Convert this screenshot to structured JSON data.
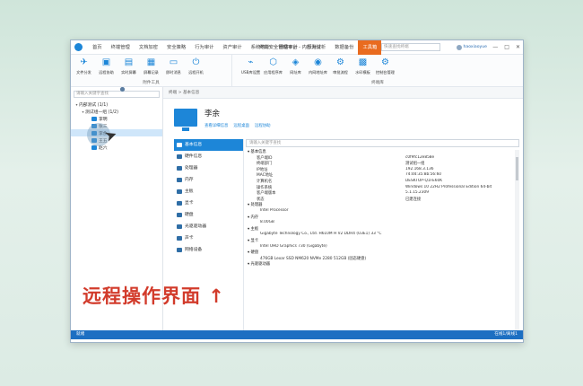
{
  "header": {
    "menu": [
      "首页",
      "终端管理",
      "文档加密",
      "安全策略",
      "行为审计",
      "资产审计",
      "系统统计",
      "网络审计",
      "行为分析",
      "数据备份",
      "工具箱",
      "系统管理"
    ],
    "active_menu": "工具箱",
    "title": "终端安全管理平台 - 内部测试",
    "search_placeholder": "快速查找终端",
    "user_name": "haoxiaoyue",
    "window_buttons": [
      "—",
      "□",
      "✕"
    ]
  },
  "toolbar": {
    "group1": {
      "label": "附件工具",
      "tools": [
        {
          "icon": "send-icon",
          "glyph": "✈",
          "label": "文件分发"
        },
        {
          "icon": "monitor-icon",
          "glyph": "▣",
          "label": "远程协助"
        },
        {
          "icon": "screen-icon",
          "glyph": "▤",
          "label": "实时屏幕"
        },
        {
          "icon": "terminal-icon",
          "glyph": "▦",
          "label": "屏幕记录"
        },
        {
          "icon": "chat-icon",
          "glyph": "▭",
          "label": "即时消息"
        },
        {
          "icon": "power-icon",
          "glyph": "⏻",
          "label": "远程开机"
        }
      ]
    },
    "group2": {
      "label": "终端库",
      "tools": [
        {
          "icon": "usb-icon",
          "glyph": "⌁",
          "label": "USB库设置"
        },
        {
          "icon": "app-icon",
          "glyph": "⬡",
          "label": "应用程序库"
        },
        {
          "icon": "web-icon",
          "glyph": "◈",
          "label": "网址库"
        },
        {
          "icon": "ip-icon",
          "glyph": "◉",
          "label": "内网地址库"
        },
        {
          "icon": "gear-icon",
          "glyph": "⚙",
          "label": "审批流程"
        },
        {
          "icon": "grid-icon",
          "glyph": "▩",
          "label": "水印模板"
        },
        {
          "icon": "settings-icon",
          "glyph": "⚙",
          "label": "控制台管理"
        }
      ]
    }
  },
  "left_panel": {
    "filter_placeholder": "请输入关键字查找",
    "tree": [
      {
        "label": "内部测试 (1/1)",
        "level": 0,
        "type": "user"
      },
      {
        "label": "测试组一组 (1/2)",
        "level": 1,
        "type": "user"
      },
      {
        "label": "李明",
        "level": 2,
        "type": "pc"
      },
      {
        "label": "张三",
        "level": 2,
        "type": "pc"
      },
      {
        "label": "李余",
        "level": 2,
        "type": "pc",
        "selected": true
      },
      {
        "label": "王五",
        "level": 2,
        "type": "pc"
      },
      {
        "label": "赵六",
        "level": 2,
        "type": "pc"
      }
    ]
  },
  "detail": {
    "breadcrumb": "终端 > 基本信息",
    "device_name": "李余",
    "actions": [
      "查看详细信息",
      "远程桌面",
      "远程协助"
    ],
    "search_placeholder": "请输入关键字查找",
    "categories": [
      {
        "label": "基本信息",
        "active": true
      },
      {
        "label": "硬件信息"
      },
      {
        "label": "处理器"
      },
      {
        "label": "内存"
      },
      {
        "label": "主板"
      },
      {
        "label": "显卡"
      },
      {
        "label": "硬盘"
      },
      {
        "label": "光驱驱动器"
      },
      {
        "label": "声卡"
      },
      {
        "label": "网络设备"
      }
    ],
    "rows": [
      {
        "type": "sec",
        "k": "▾ 基本信息",
        "v": ""
      },
      {
        "type": "row",
        "k": "客户端ID",
        "v": "c0f9fc12e858e"
      },
      {
        "type": "row",
        "k": "终端部门",
        "v": "测试组一组"
      },
      {
        "type": "row",
        "k": "IP地址",
        "v": "192.168.3.136"
      },
      {
        "type": "row",
        "k": "MAC地址",
        "v": "74:d4:35:8b:56:60"
      },
      {
        "type": "row",
        "k": "计算机名",
        "v": "DESKTOP-Q1FE60K"
      },
      {
        "type": "row",
        "k": "操作系统",
        "v": "Windows 10 22H2 Professional Edition 64-bit"
      },
      {
        "type": "row",
        "k": "客户端版本",
        "v": "5.1.15.2309"
      },
      {
        "type": "row",
        "k": "状态",
        "v": "已建连接"
      },
      {
        "type": "sec",
        "k": "▾ 处理器",
        "v": ""
      },
      {
        "type": "val",
        "k": "Intel Processor",
        "v": ""
      },
      {
        "type": "sec",
        "k": "▾ 内存",
        "v": ""
      },
      {
        "type": "val",
        "k": "8.00GB",
        "v": ""
      },
      {
        "type": "sec",
        "k": "▾ 主板",
        "v": ""
      },
      {
        "type": "val",
        "k": "Gigabyte Technology Co., Ltd. H610M H V2 DDR4 (U3E1)  33 °C",
        "v": ""
      },
      {
        "type": "sec",
        "k": "▾ 显卡",
        "v": ""
      },
      {
        "type": "val",
        "k": "Intel UHD Graphics 730 (Gigabyte)",
        "v": ""
      },
      {
        "type": "sec",
        "k": "▾ 硬盘",
        "v": ""
      },
      {
        "type": "val",
        "k": "476GB Lexar SSD NM620 NVMe 2280 512GB (固态硬盘)",
        "v": ""
      },
      {
        "type": "sec",
        "k": "▾ 光驱驱动器",
        "v": ""
      }
    ]
  },
  "statusbar": {
    "left": "就绪",
    "right": "在线1/离线1"
  },
  "overlay_caption": "远程操作界面",
  "colors": {
    "accent": "#1d86d8",
    "active_menu": "#e96b1f",
    "caption": "#d23b2b"
  }
}
